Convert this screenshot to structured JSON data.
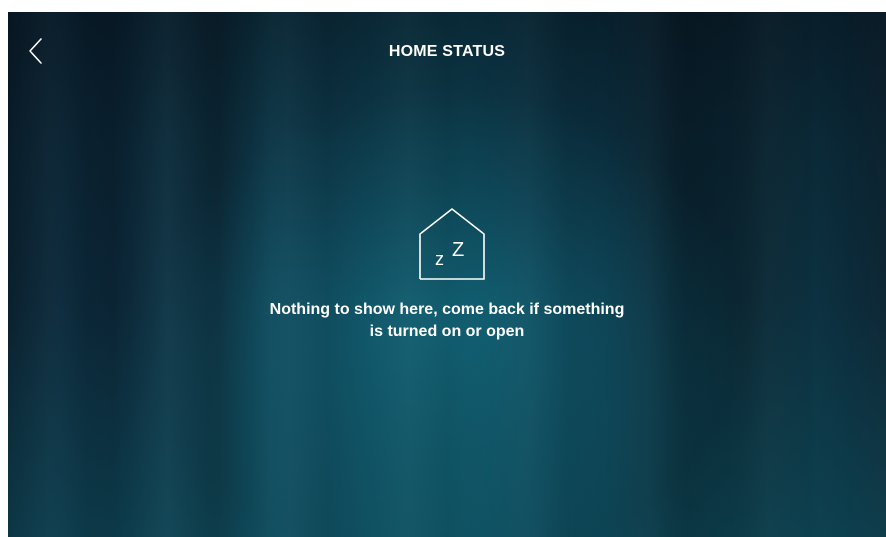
{
  "header": {
    "title": "HOME STATUS",
    "back_icon": "chevron-left-icon"
  },
  "empty_state": {
    "icon": "house-sleep-icon",
    "icon_text": "z Z",
    "message_line1": "Nothing to show here, come back if something",
    "message_line2": "is turned on or open"
  },
  "colors": {
    "text": "#ffffff",
    "background_dark": "#0a1e2c",
    "background_teal": "#0f4a5c"
  }
}
